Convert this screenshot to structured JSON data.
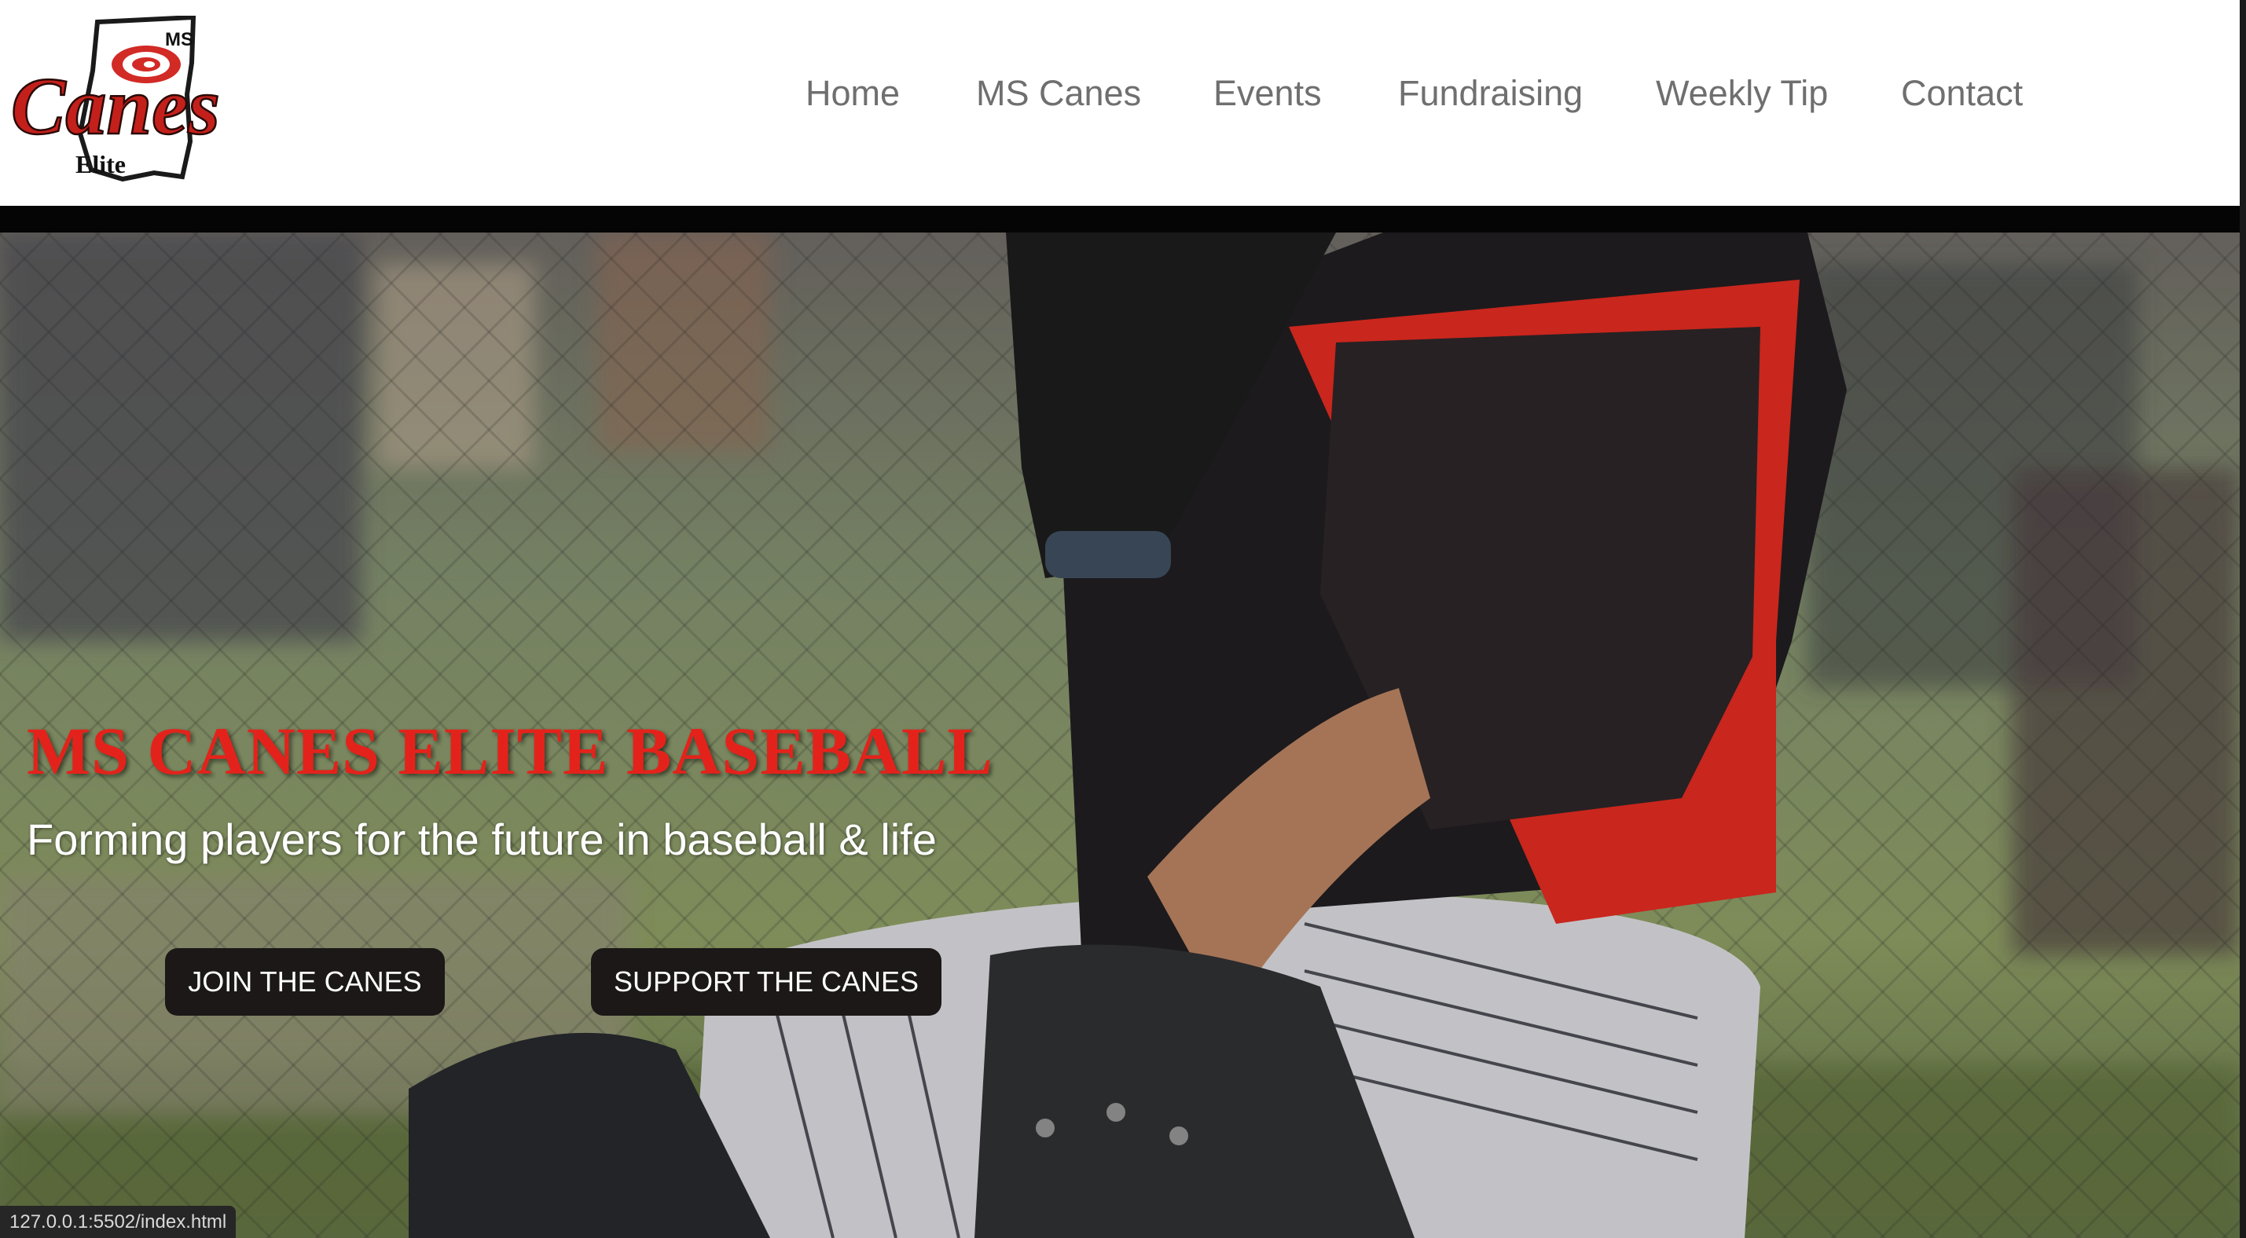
{
  "logo": {
    "text_ms": "MS",
    "text_main": "Canes",
    "text_sub": "Elite"
  },
  "nav": {
    "items": [
      {
        "label": "Home"
      },
      {
        "label": "MS Canes"
      },
      {
        "label": "Events"
      },
      {
        "label": "Fundraising"
      },
      {
        "label": "Weekly Tip"
      },
      {
        "label": "Contact"
      }
    ]
  },
  "hero": {
    "title": "MS CANES ELITE BASEBALL",
    "subtitle": "Forming players for the future in baseball & life",
    "buttons": {
      "join": "JOIN THE CANES",
      "support": "SUPPORT THE CANES"
    }
  },
  "status_bar": {
    "url": "127.0.0.1:5502/index.html"
  },
  "colors": {
    "brand_red": "#e3231b",
    "nav_text": "#6f6f6f",
    "button_bg": "#1b1817",
    "divider": "#050505"
  }
}
